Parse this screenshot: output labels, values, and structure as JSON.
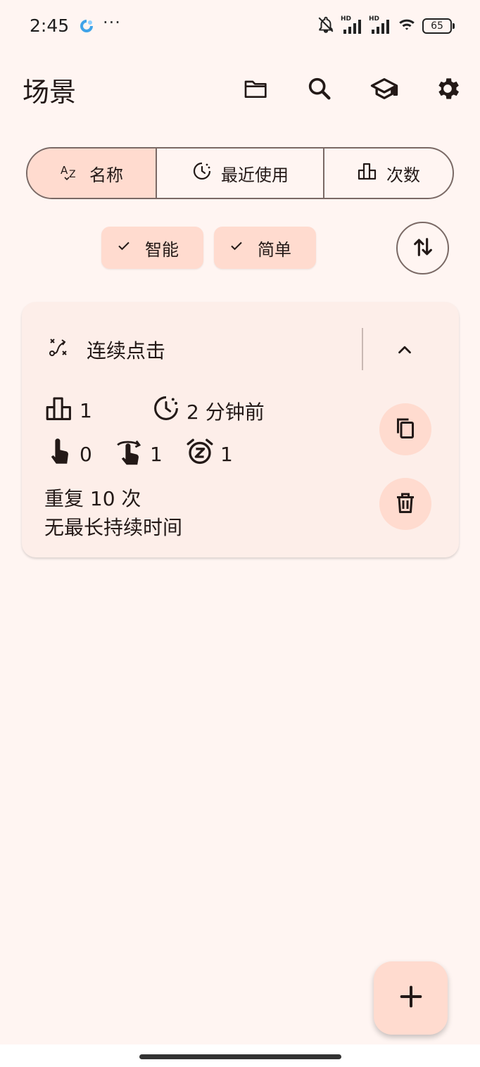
{
  "status_bar": {
    "time": "2:45",
    "dots": "···",
    "battery": "65",
    "signal_1_label": "HD",
    "signal_2_label": "HD",
    "icons": [
      "app-status-icon",
      "bell-off-icon",
      "signal-icon",
      "signal-icon",
      "wifi-icon",
      "battery-icon"
    ]
  },
  "top_bar": {
    "title": "场景",
    "actions": [
      "folder-icon",
      "search-icon",
      "school-icon",
      "gear-icon"
    ]
  },
  "sort_segments": [
    {
      "label": "名称",
      "icon": "sort-az-icon",
      "selected": true
    },
    {
      "label": "最近使用",
      "icon": "history-icon",
      "selected": false
    },
    {
      "label": "次数",
      "icon": "bar-chart-icon",
      "selected": false
    }
  ],
  "filter_chips": [
    {
      "label": "智能",
      "selected": true
    },
    {
      "label": "简单",
      "selected": true
    }
  ],
  "scenario": {
    "title": "连续点击",
    "usage_count": "1",
    "last_used": "2 分钟前",
    "click_count": "0",
    "swipe_count": "1",
    "timer_count": "1",
    "repeat_text": "重复 10 次",
    "duration_text": "无最长持续时间"
  },
  "colors": {
    "background": "#fff5f2",
    "accent_container": "#ffdbcf",
    "card": "#fdeee9",
    "outline": "#7a6965",
    "on_surface": "#231917"
  }
}
